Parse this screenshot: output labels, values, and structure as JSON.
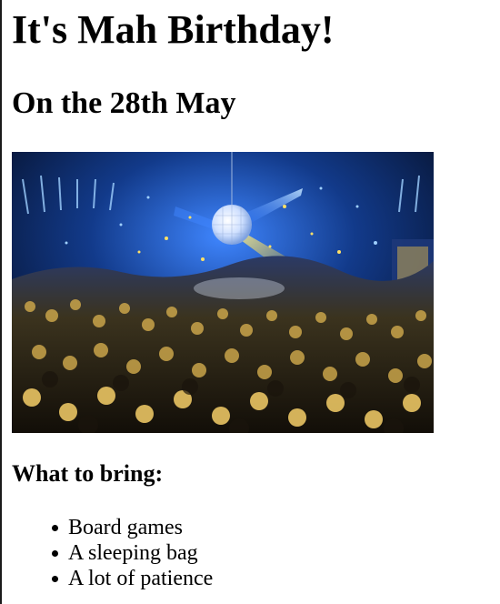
{
  "title": "It's Mah Birthday!",
  "date": "On the 28th May",
  "hero_image": {
    "subject": "party-crowd-disco-ball-photo",
    "palette": {
      "background": "#06122b",
      "blue_light": "#1e6bff",
      "gold_light": "#f2c21b",
      "crowd": "#2a2418"
    }
  },
  "bring_section": {
    "heading": "What to bring:",
    "items": [
      "Board games",
      "A sleeping bag",
      "A lot of patience"
    ]
  }
}
